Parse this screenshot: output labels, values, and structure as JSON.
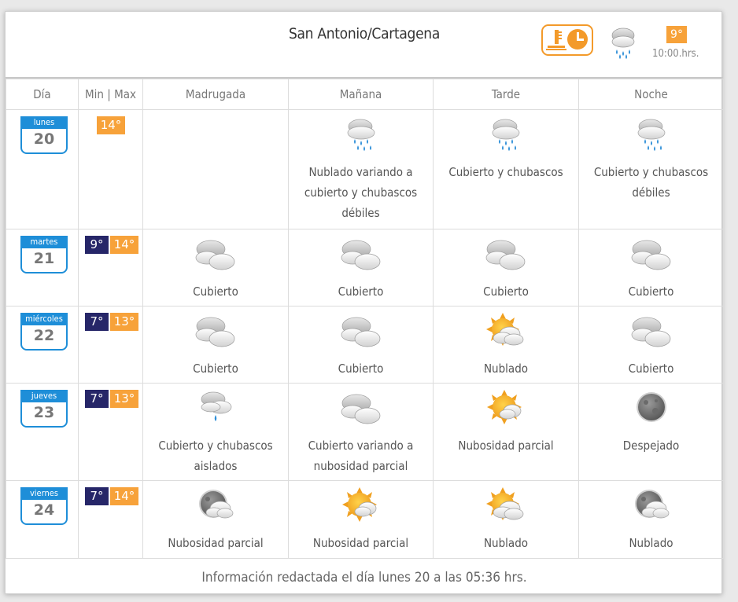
{
  "header": {
    "location": "San Antonio/Cartagena",
    "current_temp": "9°",
    "time": "10:00.hrs.",
    "current_icon": "rain-showers-icon"
  },
  "columns": {
    "day": "Día",
    "minmax": "Min | Max",
    "madrugada": "Madrugada",
    "manana": "Mañana",
    "tarde": "Tarde",
    "noche": "Noche"
  },
  "days": [
    {
      "name": "lunes",
      "num": "20",
      "min": "",
      "max": "14°",
      "periods": [
        {
          "icon": "",
          "text": ""
        },
        {
          "icon": "rain-showers-icon",
          "text": "Nublado variando a cubierto y chubascos débiles"
        },
        {
          "icon": "rain-showers-icon",
          "text": "Cubierto y chubascos"
        },
        {
          "icon": "rain-showers-icon",
          "text": "Cubierto y chubascos débiles"
        }
      ]
    },
    {
      "name": "martes",
      "num": "21",
      "min": "9°",
      "max": "14°",
      "periods": [
        {
          "icon": "cloudy-icon",
          "text": "Cubierto"
        },
        {
          "icon": "cloudy-icon",
          "text": "Cubierto"
        },
        {
          "icon": "cloudy-icon",
          "text": "Cubierto"
        },
        {
          "icon": "cloudy-icon",
          "text": "Cubierto"
        }
      ]
    },
    {
      "name": "miércoles",
      "num": "22",
      "min": "7°",
      "max": "13°",
      "periods": [
        {
          "icon": "cloudy-icon",
          "text": "Cubierto"
        },
        {
          "icon": "cloudy-icon",
          "text": "Cubierto"
        },
        {
          "icon": "sun-cloud-icon",
          "text": "Nublado"
        },
        {
          "icon": "cloudy-icon",
          "text": "Cubierto"
        }
      ]
    },
    {
      "name": "jueves",
      "num": "23",
      "min": "7°",
      "max": "13°",
      "periods": [
        {
          "icon": "isolated-shower-icon",
          "text": "Cubierto y chubascos aislados"
        },
        {
          "icon": "cloudy-icon",
          "text": "Cubierto variando a nubosidad parcial"
        },
        {
          "icon": "partly-sunny-icon",
          "text": "Nubosidad parcial"
        },
        {
          "icon": "moon-icon",
          "text": "Despejado"
        }
      ]
    },
    {
      "name": "viernes",
      "num": "24",
      "min": "7°",
      "max": "14°",
      "periods": [
        {
          "icon": "moon-cloud-icon",
          "text": "Nubosidad parcial"
        },
        {
          "icon": "partly-sunny-icon",
          "text": "Nubosidad parcial"
        },
        {
          "icon": "sun-cloud-icon",
          "text": "Nublado"
        },
        {
          "icon": "moon-cloud-icon",
          "text": "Nublado"
        }
      ]
    }
  ],
  "footer": "Información redactada el día lunes 20 a las 05:36 hrs.",
  "colors": {
    "accent_blue": "#1e8ed8",
    "max_temp": "#f7a23a",
    "min_temp": "#262668"
  }
}
